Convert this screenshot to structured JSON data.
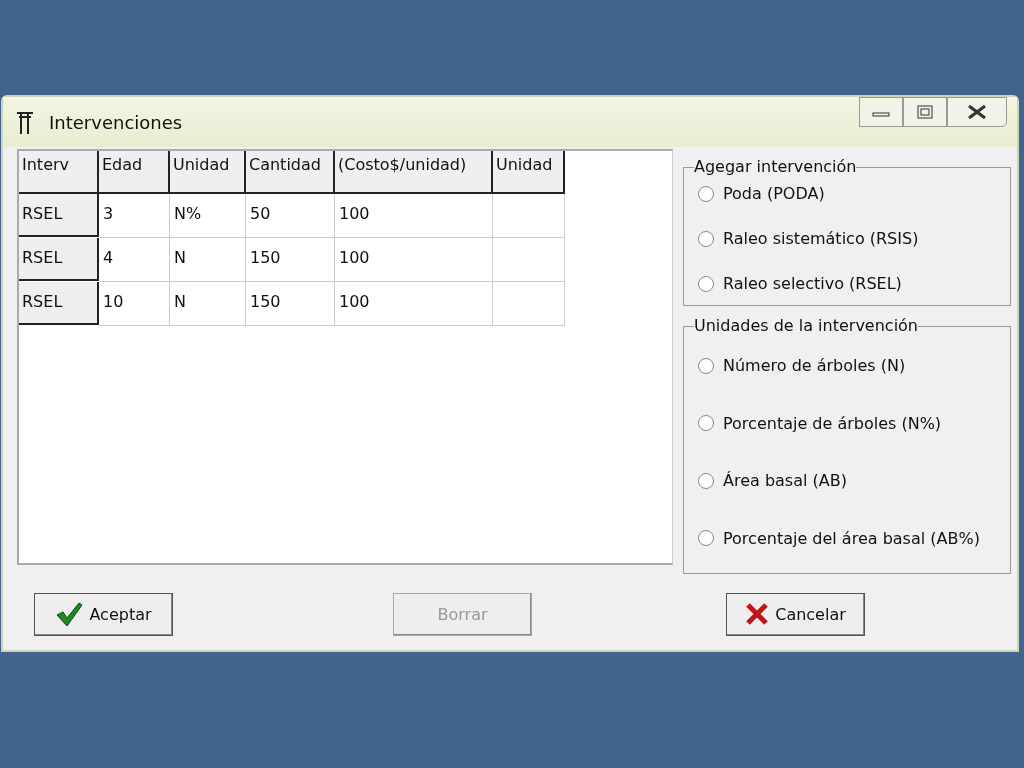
{
  "window": {
    "title": "Intervenciones"
  },
  "table": {
    "columns": [
      "Interv",
      "Edad",
      "Unidad",
      "Cantidad",
      "(Costo$/unidad)",
      "Unidad"
    ],
    "rows": [
      [
        "RSEL",
        "3",
        "N%",
        "50",
        "100",
        ""
      ],
      [
        "RSEL",
        "4",
        "N",
        "150",
        "100",
        ""
      ],
      [
        "RSEL",
        "10",
        "N",
        "150",
        "100",
        ""
      ]
    ]
  },
  "groups": [
    {
      "title": "Agegar intervención",
      "options": [
        {
          "label": "Poda (PODA)",
          "selected": false
        },
        {
          "label": "Raleo sistemático (RSIS)",
          "selected": false
        },
        {
          "label": "Raleo selectivo (RSEL)",
          "selected": false
        }
      ]
    },
    {
      "title": "Unidades de la intervención",
      "options": [
        {
          "label": "Número de árboles (N)",
          "selected": false
        },
        {
          "label": "Porcentaje de árboles (N%)",
          "selected": false
        },
        {
          "label": "Área basal (AB)",
          "selected": false
        },
        {
          "label": "Porcentaje del área basal (AB%)",
          "selected": false
        }
      ]
    }
  ],
  "buttons": [
    {
      "label": "Aceptar",
      "kind": "accept",
      "disabled": false
    },
    {
      "label": "Borrar",
      "kind": "plain",
      "disabled": true
    },
    {
      "label": "Cancelar",
      "kind": "cancel",
      "disabled": false
    }
  ]
}
